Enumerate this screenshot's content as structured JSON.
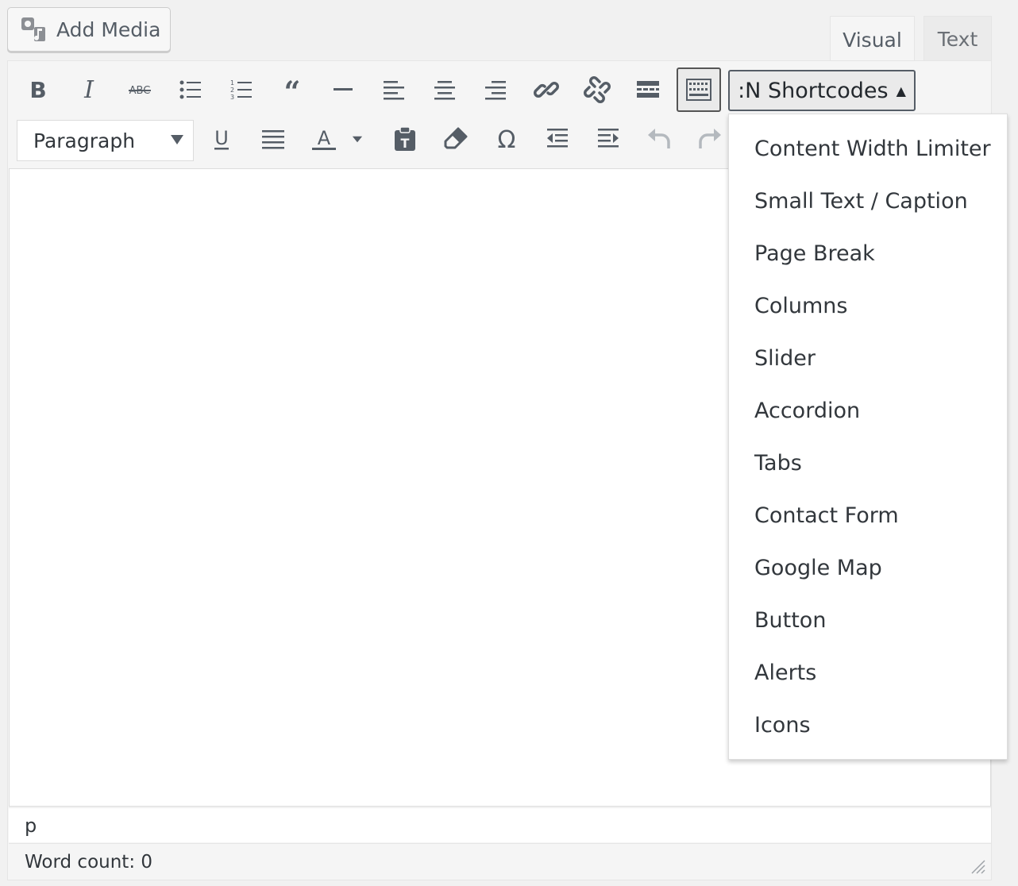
{
  "media": {
    "add_label": "Add Media"
  },
  "tabs": {
    "visual": "Visual",
    "text": "Text"
  },
  "toolbar": {
    "shortcodes_label": ":N Shortcodes",
    "shortcodes_arrow": "▲",
    "format_value": "Paragraph",
    "row1_icons": [
      "bold-icon",
      "italic-icon",
      "strikethrough-icon",
      "bulleted-list-icon",
      "numbered-list-icon",
      "blockquote-icon",
      "horizontal-line-icon",
      "align-left-icon",
      "align-center-icon",
      "align-right-icon",
      "link-icon",
      "unlink-icon",
      "read-more-icon",
      "toolbar-toggle-icon"
    ],
    "row2_icons": [
      "underline-icon",
      "justify-icon",
      "text-color-icon",
      "paste-as-text-icon",
      "clear-formatting-icon",
      "special-character-icon",
      "outdent-icon",
      "indent-icon",
      "undo-icon",
      "redo-icon"
    ]
  },
  "shortcodes_menu": {
    "items": [
      "Content Width Limiter",
      "Small Text / Caption",
      "Page Break",
      "Columns",
      "Slider",
      "Accordion",
      "Tabs",
      "Contact Form",
      "Google Map",
      "Button",
      "Alerts",
      "Icons"
    ]
  },
  "path": {
    "element": "p"
  },
  "status": {
    "word_count": "Word count: 0"
  },
  "colors": {
    "icon": "#555d66",
    "disabled_icon": "#b4b9be",
    "background": "#f1f1f1"
  }
}
